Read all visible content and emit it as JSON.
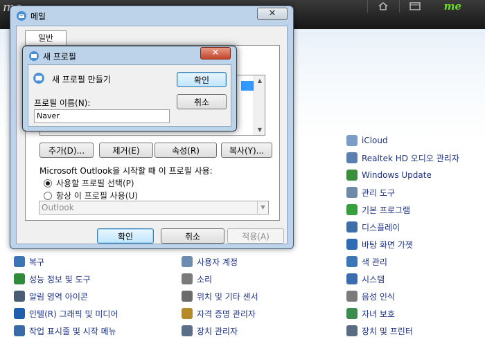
{
  "background": {
    "top_bar": {
      "brand_left": "me",
      "brand_right": "me"
    },
    "control_panel_items": [
      {
        "label": "iCloud",
        "icon": "cloud-icon",
        "color": "#7a9cc6"
      },
      {
        "label": "Realtek HD 오디오 관리자",
        "icon": "speaker-icon",
        "color": "#5a7fb0"
      },
      {
        "label": "Windows Update",
        "icon": "windows-update-icon",
        "color": "#3b8f3b"
      },
      {
        "label": "관리 도구",
        "icon": "tools-icon",
        "color": "#6f8aa8"
      },
      {
        "label": "기본 프로그램",
        "icon": "default-programs-icon",
        "color": "#36a03c"
      },
      {
        "label": "디스플레이",
        "icon": "display-icon",
        "color": "#3f6fa8"
      },
      {
        "label": "바탕 화면 가젯",
        "icon": "gadgets-icon",
        "color": "#2d6db4"
      },
      {
        "label": "색 관리",
        "icon": "color-management-icon",
        "color": "#3a76b8"
      },
      {
        "label": "시스템",
        "icon": "system-icon",
        "color": "#3b6cb0"
      },
      {
        "label": "음성 인식",
        "icon": "microphone-icon",
        "color": "#7b7b7b"
      },
      {
        "label": "자녀 보호",
        "icon": "parental-controls-icon",
        "color": "#3a8d4e"
      },
      {
        "label": "장치 및 프린터",
        "icon": "printer-icon",
        "color": "#566d84"
      },
      {
        "label": "복구",
        "icon": "recovery-icon",
        "color": "#3c74b5"
      },
      {
        "label": "사용자 계정",
        "icon": "user-accounts-icon",
        "color": "#6c8db0"
      },
      {
        "label": "성능 정보 및 도구",
        "icon": "performance-icon",
        "color": "#2f8a3c"
      },
      {
        "label": "소리",
        "icon": "sound-icon",
        "color": "#7a7a7a"
      },
      {
        "label": "알림 영역 아이콘",
        "icon": "notification-icon",
        "color": "#4a5d74"
      },
      {
        "label": "위치 및 기타 센서",
        "icon": "sensor-icon",
        "color": "#6b6b6b"
      },
      {
        "label": "인텔(R) 그래픽 및 미디어",
        "icon": "intel-graphics-icon",
        "color": "#1f5fae"
      },
      {
        "label": "자격 증명 관리자",
        "icon": "credential-icon",
        "color": "#b58a2a"
      },
      {
        "label": "작업 표시줄 및 시작 메뉴",
        "icon": "taskbar-icon",
        "color": "#3b6aa8"
      },
      {
        "label": "장치 관리자",
        "icon": "device-manager-icon",
        "color": "#5b7088"
      }
    ]
  },
  "mail_dialog": {
    "title": "메일",
    "close": "✕",
    "tab_general": "일반",
    "buttons": {
      "add": "추가(D)...",
      "remove": "제거(E)",
      "properties": "속성(R)",
      "copy": "복사(Y)..."
    },
    "startup_label": "Microsoft Outlook을 시작할 때 이 프로필 사용:",
    "radio_prompt": "사용할 프로필 선택(P)",
    "radio_always": "항상 이 프로필 사용(U)",
    "profile_combo_value": "Outlook",
    "ok": "확인",
    "cancel": "취소",
    "apply": "적용(A)"
  },
  "new_profile_dialog": {
    "title": "새 프로필",
    "close": "✕",
    "heading": "새 프로필 만들기",
    "field_label": "프로필 이름(N):",
    "field_value": "Naver",
    "ok": "확인",
    "cancel": "취소"
  }
}
